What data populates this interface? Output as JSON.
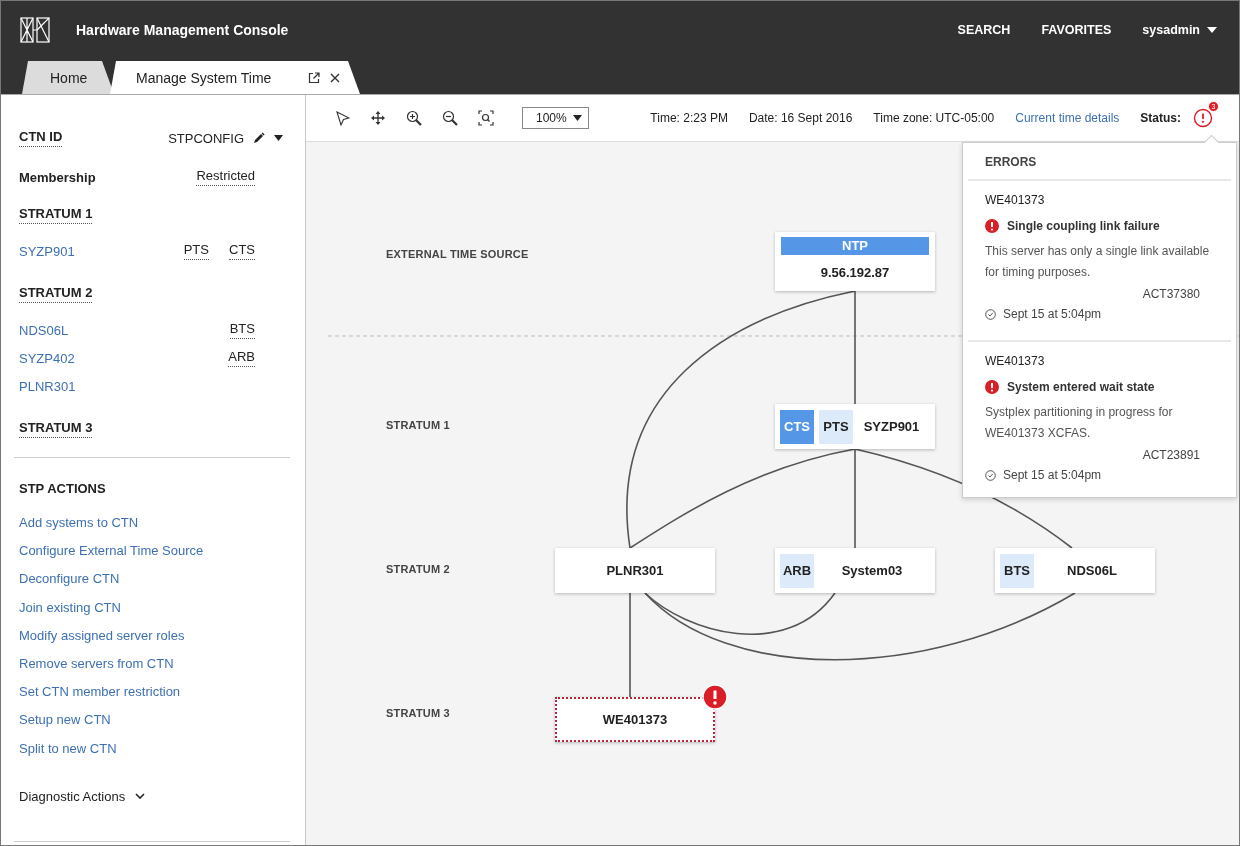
{
  "header": {
    "title": "Hardware Management Console",
    "nav": [
      "SEARCH",
      "FAVORITES"
    ],
    "user": "sysadmin"
  },
  "tabs": [
    {
      "label": "Home",
      "selected": false
    },
    {
      "label": "Manage System Time",
      "selected": true
    }
  ],
  "sidebar": {
    "ctn_id": {
      "label": "CTN ID",
      "value": "STPCONFIG"
    },
    "membership": {
      "label": "Membership",
      "value": "Restricted"
    },
    "strata": [
      {
        "heading": "STRATUM 1",
        "systems": [
          {
            "name": "SYZP901",
            "roles": [
              "PTS",
              "CTS"
            ]
          }
        ]
      },
      {
        "heading": "STRATUM 2",
        "systems": [
          {
            "name": "NDS06L",
            "roles": [
              "BTS"
            ]
          },
          {
            "name": "SYZP402",
            "roles": [
              "ARB"
            ]
          },
          {
            "name": "PLNR301"
          }
        ]
      },
      {
        "heading": "STRATUM 3"
      }
    ],
    "stp_actions": {
      "heading": "STP ACTIONS",
      "items": [
        "Add systems to CTN",
        "Configure External Time Source",
        "Deconfigure CTN",
        "Join existing CTN",
        "Modify assigned server roles",
        "Remove servers from CTN",
        "Set CTN member restriction",
        "Setup new CTN",
        "Split to new CTN"
      ]
    },
    "diagnostic": {
      "label": "Diagnostic Actions",
      "expanded": false
    }
  },
  "toolbar": {
    "zoom": "100%",
    "time": "Time: 2:23 PM",
    "date": "Date: 16 Sept 2016",
    "timezone": "Time zone: UTC-05:00",
    "details_link": "Current time details",
    "status_label": "Status:",
    "status_count": "3"
  },
  "diagram": {
    "levels": [
      {
        "label": "EXTERNAL TIME SOURCE",
        "nodes": [
          {
            "kind": "source",
            "header": "NTP",
            "name": "9.56.192.87",
            "error": false
          }
        ]
      },
      {
        "label": "STRATUM 1",
        "nodes": [
          {
            "kind": "server",
            "name": "SYZP901",
            "error": false,
            "roles": [
              {
                "label": "CTS",
                "kind": "primary"
              },
              {
                "label": "PTS",
                "kind": "secondary"
              }
            ]
          }
        ]
      },
      {
        "label": "STRATUM 2",
        "nodes": [
          {
            "kind": "server",
            "name": "PLNR301",
            "error": false
          },
          {
            "kind": "server",
            "name": "System03",
            "error": false,
            "roles": [
              {
                "label": "ARB",
                "kind": "secondary"
              }
            ]
          },
          {
            "kind": "server",
            "name": "NDS06L",
            "error": false,
            "roles": [
              {
                "label": "BTS",
                "kind": "secondary"
              }
            ]
          }
        ]
      },
      {
        "label": "STRATUM 3",
        "nodes": [
          {
            "kind": "server",
            "name": "WE401373",
            "error": true
          }
        ]
      }
    ]
  },
  "errors": {
    "title": "ERRORS",
    "items": [
      {
        "system": "WE401373",
        "title": "Single coupling link failure",
        "description": "This server has only a single link available for timing purposes.",
        "code": "ACT37380",
        "time": "Sept 15 at 5:04pm"
      },
      {
        "system": "WE401373",
        "title": "System entered wait state",
        "description": "Systplex partitioning in progress for WE401373 XCFAS.",
        "code": "ACT23891",
        "time": "Sept 15 at 5:04pm"
      }
    ]
  }
}
